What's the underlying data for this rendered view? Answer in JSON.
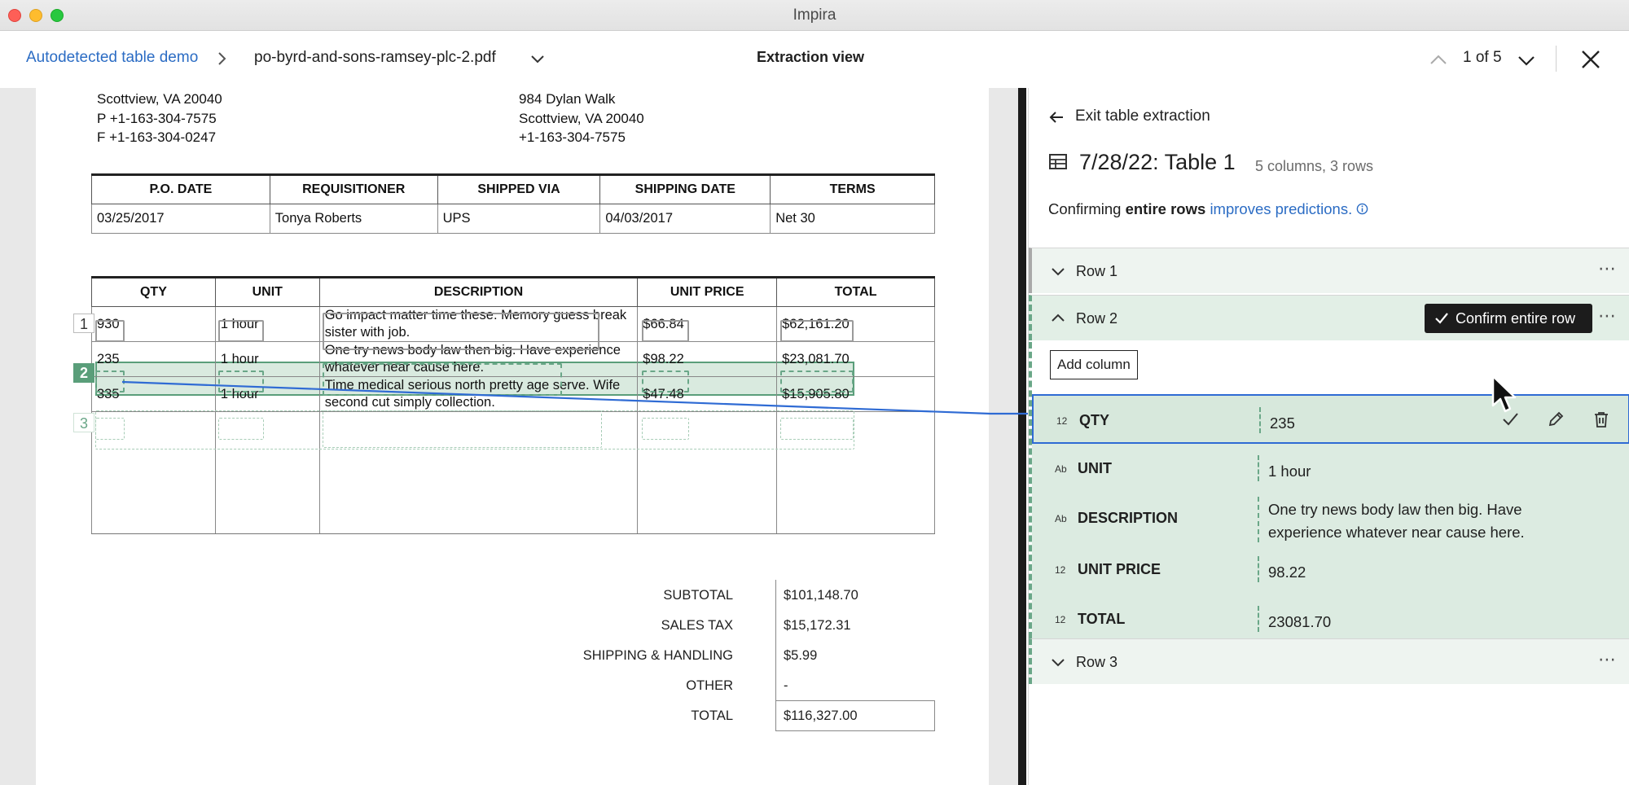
{
  "window": {
    "title": "Impira"
  },
  "header": {
    "breadcrumb_link": "Autodetected table demo",
    "file_name": "po-byrd-and-sons-ramsey-plc-2.pdf",
    "view_title": "Extraction view",
    "pager": "1 of 5"
  },
  "document": {
    "vendor_lines": [
      "Scottview, VA 20040",
      "P +1-163-304-7575",
      "F +1-163-304-0247"
    ],
    "ship_lines": [
      "984 Dylan Walk",
      "Scottview, VA 20040",
      "+1-163-304-7575"
    ],
    "order_table": {
      "headers": [
        "P.O. DATE",
        "REQUISITIONER",
        "SHIPPED VIA",
        "SHIPPING DATE",
        "TERMS"
      ],
      "row": [
        "03/25/2017",
        "Tonya Roberts",
        "UPS",
        "04/03/2017",
        "Net 30"
      ]
    },
    "items_table": {
      "headers": [
        "QTY",
        "UNIT",
        "DESCRIPTION",
        "UNIT PRICE",
        "TOTAL"
      ],
      "rows": [
        [
          "930",
          "1 hour",
          "Go impact matter time these. Memory guess break sister with job.",
          "$66.84",
          "$62,161.20"
        ],
        [
          "235",
          "1 hour",
          "One try news body law then big. Have experience whatever near cause here.",
          "$98.22",
          "$23,081.70"
        ],
        [
          "335",
          "1 hour",
          "Time medical serious north pretty age serve. Wife second cut simply collection.",
          "$47.48",
          "$15,905.80"
        ]
      ],
      "row_numbers": [
        "1",
        "2",
        "3"
      ]
    },
    "totals": [
      {
        "label": "SUBTOTAL",
        "value": "$101,148.70"
      },
      {
        "label": "SALES TAX",
        "value": "$15,172.31"
      },
      {
        "label": "SHIPPING & HANDLING",
        "value": "$5.99"
      },
      {
        "label": "OTHER",
        "value": "-"
      },
      {
        "label": "TOTAL",
        "value": "$116,327.00"
      }
    ]
  },
  "panel": {
    "exit_label": "Exit table extraction",
    "table_title": "7/28/22: Table 1",
    "table_meta": "5 columns, 3 rows",
    "hint_prefix": "Confirming ",
    "hint_bold": "entire rows",
    "hint_link": "improves predictions.",
    "rows": [
      {
        "label": "Row 1"
      },
      {
        "label": "Row 2"
      },
      {
        "label": "Row 3"
      }
    ],
    "confirm_label": "Confirm entire row",
    "add_column_label": "Add column",
    "fields": [
      {
        "type": "12",
        "name": "QTY",
        "value": "235"
      },
      {
        "type": "Ab",
        "name": "UNIT",
        "value": "1 hour"
      },
      {
        "type": "Ab",
        "name": "DESCRIPTION",
        "value": "One try news body law then big. Have experience whatever near cause here."
      },
      {
        "type": "12",
        "name": "UNIT PRICE",
        "value": "98.22"
      },
      {
        "type": "12",
        "name": "TOTAL",
        "value": "23081.70"
      }
    ]
  },
  "icons": [
    "chevron-right-icon",
    "chevron-down-icon",
    "chevron-up-icon",
    "close-icon",
    "arrow-left-icon",
    "table-icon",
    "info-icon",
    "more-icon",
    "check-icon",
    "pencil-icon",
    "trash-icon",
    "cursor-icon"
  ],
  "colors": {
    "accent_link": "#2b6cc4",
    "selection_blue": "#2f6bd4",
    "row_green": "#5a9e7a",
    "row_bg": "#dcebe1",
    "confirm_bg": "#1c1c1c"
  }
}
